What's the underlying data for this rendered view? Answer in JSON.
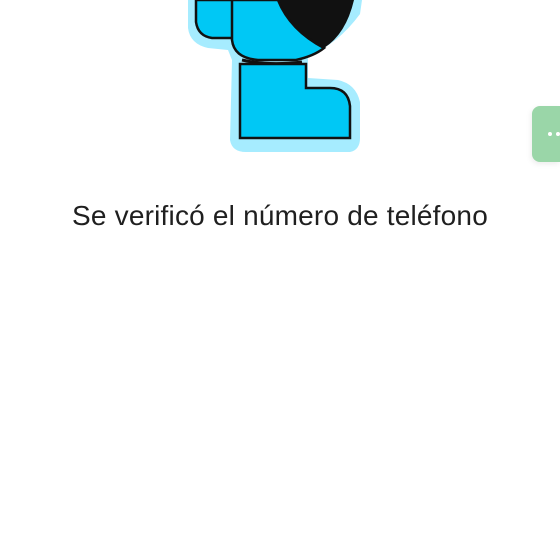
{
  "status": {
    "message": "Se verificó el número de teléfono"
  },
  "illustration": {
    "icon": "verified-person-illustration",
    "colors": {
      "glow": "#a6ecff",
      "fill": "#00c8f5",
      "outline": "#111111"
    }
  },
  "side_tab": {
    "icon": "more-dots-icon",
    "color": "#9ad6a8"
  }
}
